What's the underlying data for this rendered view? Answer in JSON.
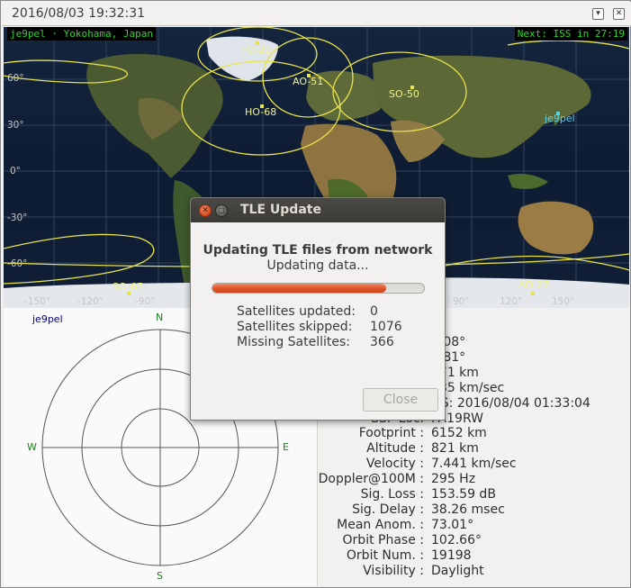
{
  "window": {
    "title": "2016/08/03 19:32:31",
    "buttons": [
      "▾",
      "✕"
    ]
  },
  "map": {
    "qth_label": "je9pel · Yokohama, Japan",
    "next_pass": "Next: ISS in 27:19",
    "ground_station": "je9pel",
    "satellites": [
      "FO-29",
      "AO-51",
      "SO-50",
      "HO-68",
      "SO-67",
      "AO-27"
    ],
    "latitudes": [
      "60°",
      "30°",
      "0°",
      "-30°",
      "-60°"
    ],
    "longitudes": [
      "-150°",
      "-120°",
      "-90°",
      "90°",
      "120°",
      "150°"
    ],
    "colors": {
      "footprint": "#e8e34a",
      "overlay_text": "#31d431",
      "qth": "#59d4e6"
    }
  },
  "polar": {
    "qth": "je9pel",
    "north": "N",
    "south": "S",
    "east": "E",
    "west": "W"
  },
  "details": {
    "partial_rows": [
      {
        "label": "",
        "value": "3.08°"
      },
      {
        "label": "",
        "value": "5.81°"
      },
      {
        "label": "",
        "value": "471 km"
      },
      {
        "label": "",
        "value": "885 km/sec"
      },
      {
        "label": "",
        "value": "DS: 2016/08/04 01:33:04"
      },
      {
        "label": "SSP Loc.",
        "value": "PA19RW"
      }
    ],
    "rows": [
      {
        "label": "Footprint :",
        "value": "6152 km"
      },
      {
        "label": "Altitude :",
        "value": "821 km"
      },
      {
        "label": "Velocity :",
        "value": "7.441 km/sec"
      },
      {
        "label": "Doppler@100M :",
        "value": "295 Hz"
      },
      {
        "label": "Sig. Loss :",
        "value": "153.59 dB"
      },
      {
        "label": "Sig. Delay :",
        "value": "38.26 msec"
      },
      {
        "label": "Mean Anom. :",
        "value": "73.01°"
      },
      {
        "label": "Orbit Phase :",
        "value": "102.66°"
      },
      {
        "label": "Orbit Num. :",
        "value": "19198"
      },
      {
        "label": "Visibility :",
        "value": "Daylight"
      }
    ]
  },
  "dialog": {
    "title": "TLE Update",
    "heading": "Updating TLE files from network",
    "status": "Updating data...",
    "progress": 0.82,
    "stats": [
      {
        "label": "Satellites updated:",
        "value": "0"
      },
      {
        "label": "Satellites skipped:",
        "value": "1076"
      },
      {
        "label": "Missing Satellites:",
        "value": "366"
      }
    ],
    "close_label": "Close",
    "progress_color": "#dd5325"
  }
}
